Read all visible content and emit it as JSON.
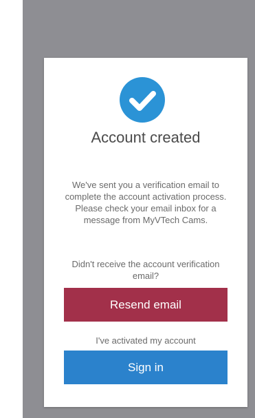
{
  "dialog": {
    "title": "Account created",
    "message": "We've sent you a verification email to complete the account activation process. Please check your email inbox for a message from MyVTech Cams.",
    "notice": "Didn't receive the account verification email?",
    "resend_label": "Resend email",
    "activated_hint": "I've activated my account",
    "signin_label": "Sign in",
    "icon": "check-circle-icon"
  },
  "colors": {
    "backdrop": "#8e8e93",
    "accent": "#2b93d6",
    "resend": "#a2304a",
    "signin": "#2b82cc"
  }
}
